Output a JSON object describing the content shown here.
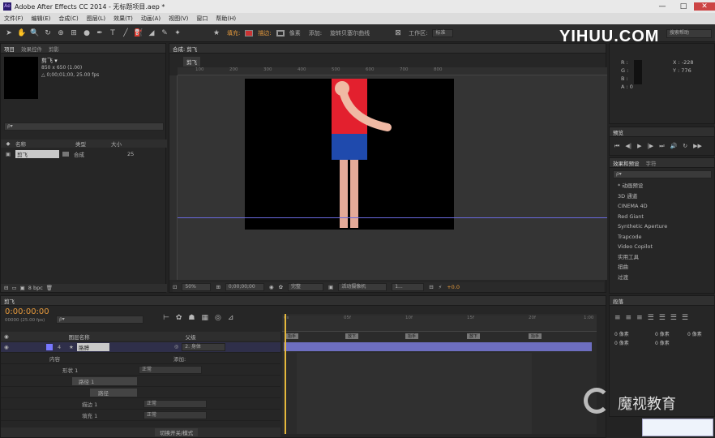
{
  "title_bar": {
    "app_title": "Adobe After Effects CC 2014 - 无标题项目.aep *"
  },
  "menu": [
    "文件(F)",
    "编辑(E)",
    "合成(C)",
    "图层(L)",
    "效果(T)",
    "动画(A)",
    "视图(V)",
    "窗口",
    "帮助(H)"
  ],
  "toolbar": {
    "fill_label": "填充:",
    "stroke_label": "描边:",
    "px_label": "像素",
    "add_label": "添加:",
    "bezier_label": "旋转贝塞尔曲线",
    "workspace_label": "工作区:",
    "workspace_value": "标准",
    "search_placeholder": "搜索帮助"
  },
  "watermark_top": "YIHUU.COM",
  "project": {
    "tabs": [
      "项目",
      "效果控件",
      "剪影"
    ],
    "comp_name": "剪飞 ▾",
    "comp_size": "850 x 650 (1.00)",
    "comp_duration": "△ 0;00;01;00, 25.00 fps",
    "search_placeholder": "ρ▾",
    "col_name": "名称",
    "col_type": "类型",
    "col_size": "大小",
    "item_name": "剪飞",
    "item_type": "合成",
    "item_size": "25",
    "bpc": "8 bpc"
  },
  "comp_panel": {
    "tab": "合成: 剪飞",
    "sub_tab": "剪飞",
    "ruler_labels": [
      "100",
      "200",
      "300",
      "400",
      "500",
      "600",
      "700",
      "800"
    ],
    "zoom": "50%",
    "timecode": "0;00;00;00",
    "quality": "完整",
    "camera": "活动摄像机",
    "views": "1...",
    "exposure": "+0.0"
  },
  "info": {
    "r": "R :",
    "g": "G :",
    "b": "B :",
    "a": "A : 0",
    "x": "X : -228",
    "y": "Y : 776"
  },
  "preview": {
    "tab": "预览"
  },
  "effects": {
    "tabs": [
      "效果和预设",
      "字符"
    ],
    "search_placeholder": "ρ▾",
    "items": [
      "* 动画预设",
      "3D 通道",
      "CINEMA 4D",
      "Red Giant",
      "Synthetic Aperture",
      "Trapcode",
      "Video Copilot",
      "实用工具",
      "扭曲",
      "过渡"
    ]
  },
  "timeline": {
    "tab": "剪飞",
    "timecode": "0:00:00:00",
    "frame_info": "00000 (25.00 fps)",
    "search_placeholder": "ρ▾",
    "col_layer_name": "图层名称",
    "col_parent": "父级",
    "layer_num": "4",
    "layer_name": "胳膊",
    "parent_value": "2. 身体",
    "rows": [
      {
        "label": "内容",
        "add": "添加:"
      },
      {
        "label": "形状 1",
        "mode": "正常"
      },
      {
        "label": "路径 1"
      },
      {
        "label": "路径"
      },
      {
        "label": "描边 1",
        "mode": "正常"
      },
      {
        "label": "填充 1",
        "mode": "正常"
      }
    ],
    "toggle_label": "切换开关/模式",
    "ruler": [
      "0s",
      "05f",
      "10f",
      "15f",
      "20f",
      "1:00"
    ],
    "markers": [
      "抬手",
      "放下",
      "抬手",
      "放下",
      "抬手"
    ]
  },
  "paragraph": {
    "tab": "段落",
    "px1": "0 像素",
    "px2": "0 像素",
    "px3": "0 像素",
    "px4": "0 像素",
    "px5": "0 像素"
  },
  "watermark_bottom": "魔视教育"
}
